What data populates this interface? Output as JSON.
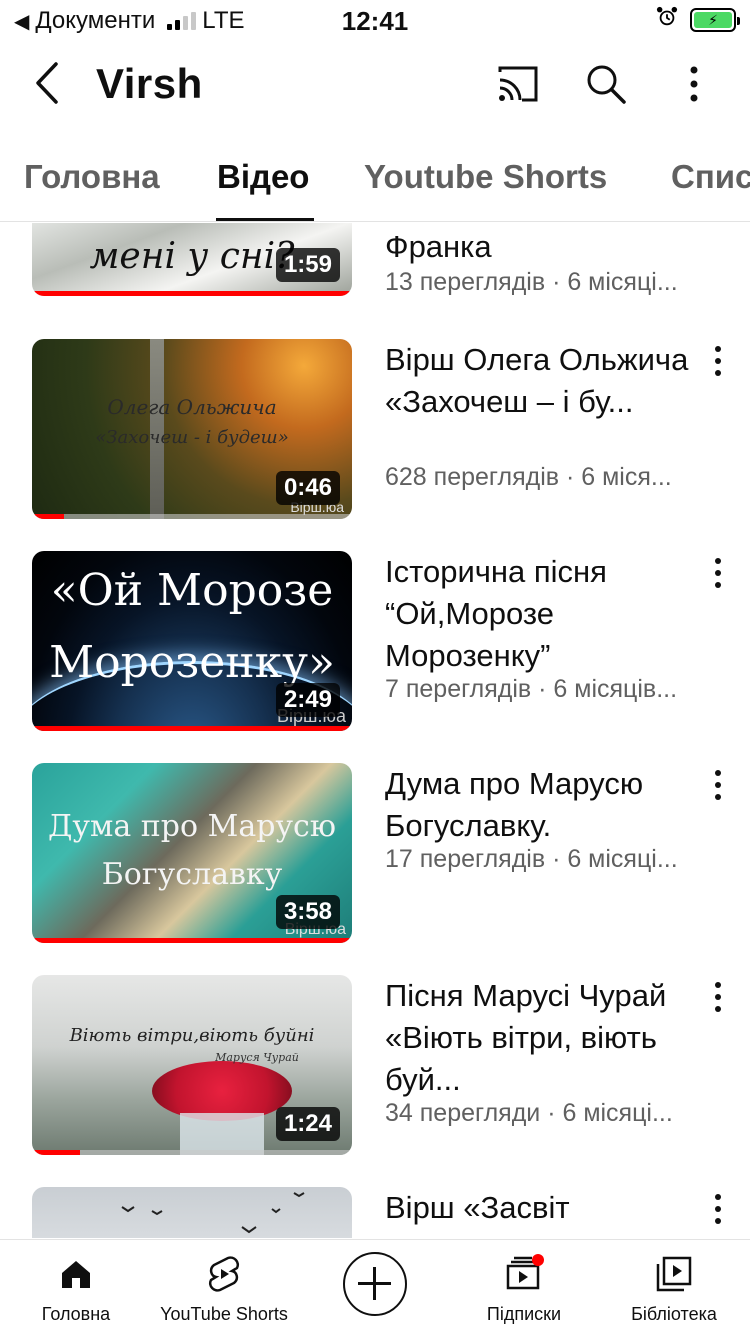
{
  "status_bar": {
    "back_app": "Документи",
    "network": "LTE",
    "time": "12:41",
    "battery_charging": true
  },
  "header": {
    "channel_title": "Virsh",
    "icons": [
      "back-chevron-icon",
      "cast-icon",
      "search-icon",
      "more-vertical-icon"
    ]
  },
  "tabs": [
    {
      "label": "Головна",
      "active": false
    },
    {
      "label": "Відео",
      "active": true
    },
    {
      "label": "Youtube Shorts",
      "active": false
    },
    {
      "label": "Спис",
      "active": false
    }
  ],
  "videos": [
    {
      "title": "Франка",
      "meta": "13 переглядів · 6 місяці...",
      "duration": "1:59",
      "thumb_text": "мені у сні?",
      "watched": 1.0,
      "show_more": false
    },
    {
      "title": "Вірш Олега Ольжича «Захочеш – і бу...",
      "meta": "628 переглядів · 6 міся...",
      "duration": "0:46",
      "thumb_text": "Олега Ольжича «Захочеш - і будеш»",
      "thumb_line1": "Олега Ольжича",
      "thumb_line2": "«Захочеш - і будеш»",
      "watermark": "Вірш.юа",
      "watched": 0.1,
      "show_more": true
    },
    {
      "title": "Історична пісня “Ой,Морозе Морозенку”",
      "meta": "7 переглядів · 6 місяців...",
      "duration": "2:49",
      "thumb_line1": "«Ой Морозе",
      "thumb_line2": "Морозенку»",
      "watermark": "Вірш.юа",
      "watched": 1.0,
      "show_more": true
    },
    {
      "title": "Дума про Марусю Богуславку.",
      "meta": "17 переглядів · 6 місяці...",
      "duration": "3:58",
      "thumb_line1": "Дума про Марусю",
      "thumb_line2": "Богуславку",
      "watermark": "Вірш.юа",
      "watched": 1.0,
      "show_more": true
    },
    {
      "title": "Пісня Марусі Чурай «Віють вітри, віють буй...",
      "meta": "34 перегляди · 6 місяці...",
      "duration": "1:24",
      "thumb_line1": "Віють вітри,віють буйні",
      "thumb_line2": "Маруся Чурай",
      "watched": 0.15,
      "show_more": true
    },
    {
      "title": "Вірш «Засвіт",
      "meta": "",
      "duration": "",
      "show_more": true
    }
  ],
  "bottom_nav": [
    {
      "label": "Головна",
      "icon": "home-icon"
    },
    {
      "label": "YouTube Shorts",
      "icon": "shorts-icon"
    },
    {
      "label": "",
      "icon": "create-plus-icon"
    },
    {
      "label": "Підписки",
      "icon": "subscriptions-icon"
    },
    {
      "label": "Бібліотека",
      "icon": "library-icon"
    }
  ],
  "colors": {
    "accent": "#ff0000",
    "text_primary": "#0f0f0f",
    "text_secondary": "#606060"
  }
}
